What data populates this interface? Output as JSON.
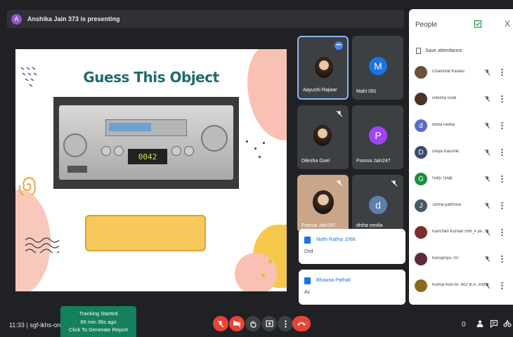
{
  "presenting": {
    "avatar_letter": "A",
    "text": "Anshika Jain 373 is presenting"
  },
  "slide": {
    "title": "Guess This Object",
    "vcr_display": "0042"
  },
  "tiles": [
    {
      "name": "Aayushi Rajwar"
    },
    {
      "name": "Mahi 091",
      "letter": "M"
    },
    {
      "name": "Dilesha Goel"
    },
    {
      "name": "Poorva Jain247",
      "letter": "P"
    },
    {
      "name": "Poorva Jain247"
    },
    {
      "name": "disha neolia",
      "letter": "d"
    }
  ],
  "chats": [
    {
      "sender": "Nidhi Rathia 1068",
      "message": "Dvd"
    },
    {
      "sender": "Bhawna Pathak",
      "message": "Ac"
    }
  ],
  "people": {
    "title": "People",
    "close": "X",
    "save_attendance": "Save attendance",
    "list": [
      {
        "name": "Chankirat Kasaur"
      },
      {
        "name": "Dilesha Goel"
      },
      {
        "name": "disha neolia",
        "letter": "d"
      },
      {
        "name": "Divya Kaushik",
        "letter": "D"
      },
      {
        "name": "Garji Tyagi",
        "letter": "G"
      },
      {
        "name": "Johna pathrose",
        "letter": "J"
      },
      {
        "name": "Kanchan Kumari 599_II ye..."
      },
      {
        "name": "Kanupriya 797"
      },
      {
        "name": "Komal Roll no. 602 B.A. 2nd ..."
      }
    ]
  },
  "bottom": {
    "meeting_info": "11:33  |  sgf-ikhs-ong",
    "tracking_line1": "Tracking Started",
    "tracking_line2": "69 min 36s ago",
    "tracking_line3": "Click To Generate Report",
    "right_info": "0"
  },
  "colors": {
    "accent": "#1a73e8",
    "red": "#ea4335",
    "tracking": "#14805e",
    "dark": "#202124"
  }
}
